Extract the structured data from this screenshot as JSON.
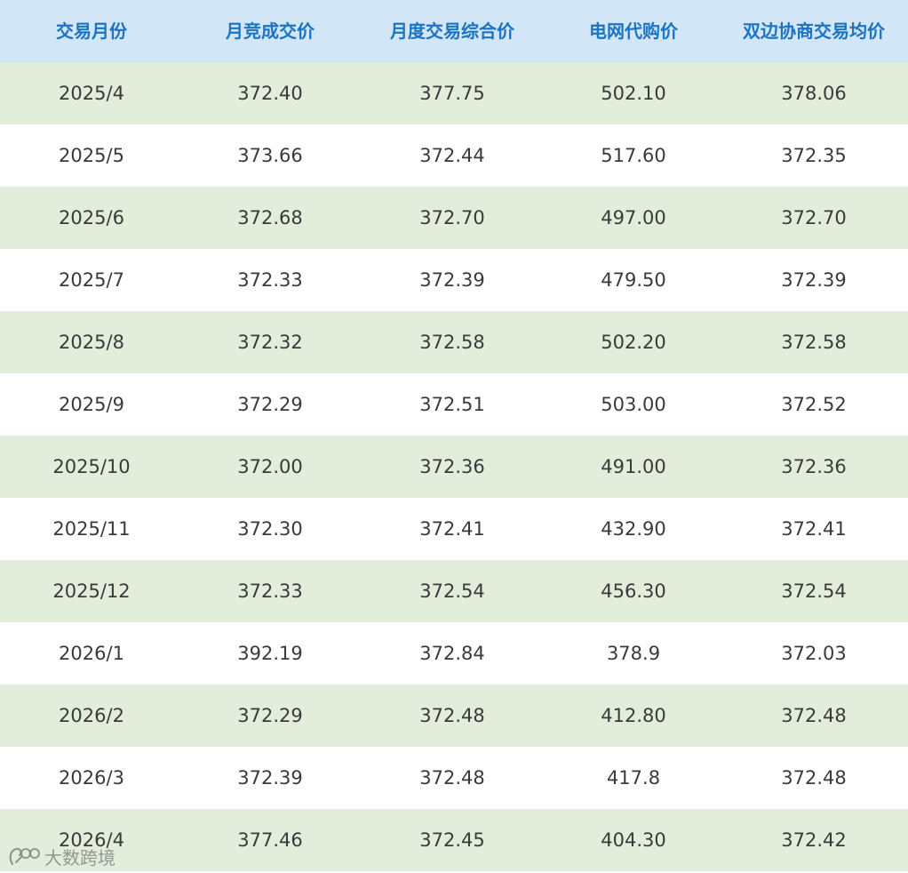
{
  "table": {
    "headers": [
      "交易月份",
      "月竞成交价",
      "月度交易综合价",
      "电网代购价",
      "双边协商交易均价"
    ],
    "rows": [
      [
        "2025/4",
        "372.40",
        "377.75",
        "502.10",
        "378.06"
      ],
      [
        "2025/5",
        "373.66",
        "372.44",
        "517.60",
        "372.35"
      ],
      [
        "2025/6",
        "372.68",
        "372.70",
        "497.00",
        "372.70"
      ],
      [
        "2025/7",
        "372.33",
        "372.39",
        "479.50",
        "372.39"
      ],
      [
        "2025/8",
        "372.32",
        "372.58",
        "502.20",
        "372.58"
      ],
      [
        "2025/9",
        "372.29",
        "372.51",
        "503.00",
        "372.52"
      ],
      [
        "2025/10",
        "372.00",
        "372.36",
        "491.00",
        "372.36"
      ],
      [
        "2025/11",
        "372.30",
        "372.41",
        "432.90",
        "372.41"
      ],
      [
        "2025/12",
        "372.33",
        "372.54",
        "456.30",
        "372.54"
      ],
      [
        "2026/1",
        "392.19",
        "372.84",
        "378.9",
        "372.03"
      ],
      [
        "2026/2",
        "372.29",
        "372.48",
        "412.80",
        "372.48"
      ],
      [
        "2026/3",
        "372.39",
        "372.48",
        "417.8",
        "372.48"
      ],
      [
        "2026/4",
        "377.46",
        "372.45",
        "404.30",
        "372.42"
      ]
    ]
  },
  "watermark": {
    "text": "大数跨境",
    "icon": "brand-logo-icon"
  },
  "colors": {
    "header_bg": "#d2e6f8",
    "header_text": "#1a74c2",
    "stripe_bg": "#e2eedb",
    "row_bg": "#ffffff",
    "cell_text": "#3a3a3a"
  }
}
